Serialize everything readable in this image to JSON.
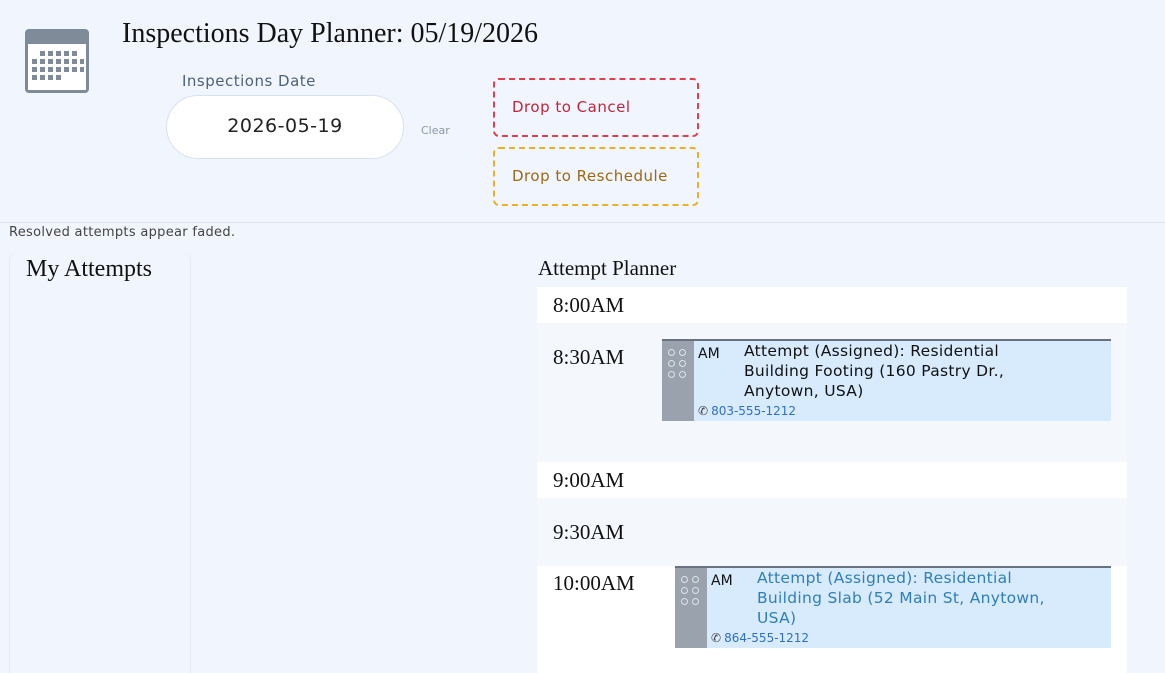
{
  "header": {
    "title": "Inspections Day Planner: 05/19/2026",
    "date_label": "Inspections Date",
    "date_value": "2026-05-19",
    "clear_label": "Clear",
    "icon": "calendar-icon"
  },
  "drop_zones": {
    "cancel_label": "Drop to Cancel",
    "reschedule_label": "Drop to Reschedule",
    "cancel_color": "#e0404e",
    "reschedule_color": "#e8b224"
  },
  "hint": "Resolved attempts appear faded.",
  "my_attempts": {
    "title": "My Attempts"
  },
  "planner": {
    "title": "Attempt Planner",
    "slots": [
      {
        "time": "8:00AM"
      },
      {
        "time": "8:30AM"
      },
      {
        "time": "9:00AM"
      },
      {
        "time": "9:30AM"
      },
      {
        "time": "10:00AM"
      }
    ],
    "attempts": [
      {
        "ampm": "AM",
        "title": "Attempt (Assigned): Residential Building Footing (160 Pastry Dr., Anytown, USA)",
        "phone": "803-555-1212",
        "faded": false
      },
      {
        "ampm": "AM",
        "title": "Attempt (Assigned): Residential Building Slab (52 Main St, Anytown, USA)",
        "phone": "864-555-1212",
        "faded": true
      }
    ]
  },
  "colors": {
    "background": "#f1f5fd",
    "attempt_fill": "#d7ebfd",
    "handle": "#9aa2ae",
    "phone_link": "#2f6fc4"
  }
}
